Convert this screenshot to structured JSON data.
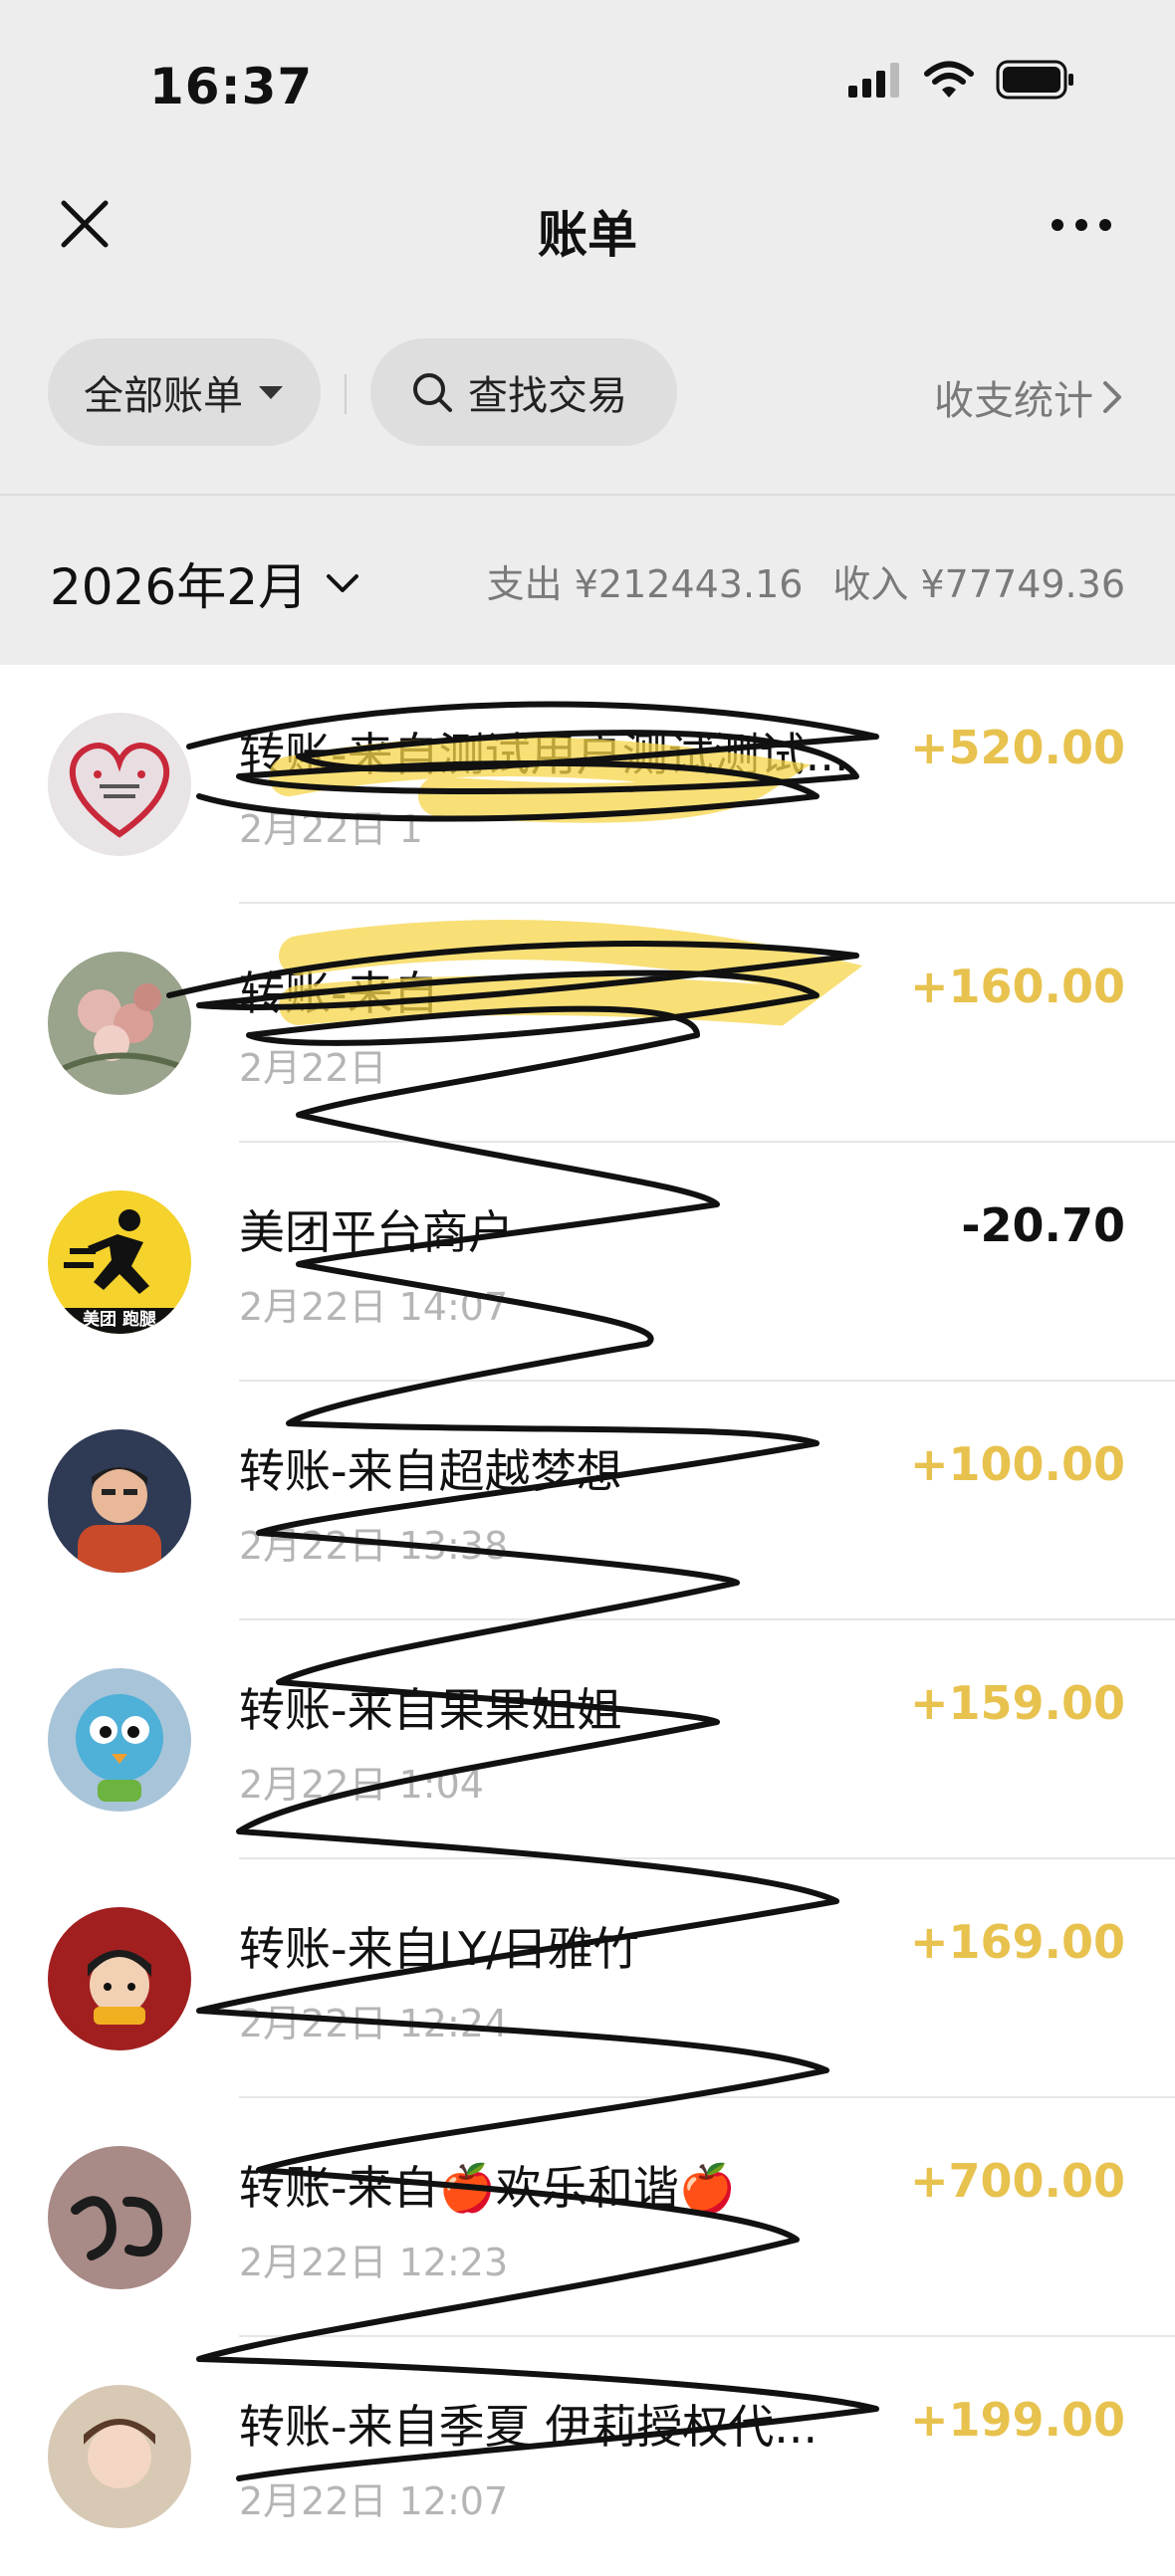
{
  "status_bar": {
    "time": "16:37"
  },
  "nav": {
    "title": "账单"
  },
  "filters": {
    "all_bills": "全部账单",
    "search": "查找交易",
    "stats": "收支统计"
  },
  "summary": {
    "month": "2026年2月",
    "expense": "支出 ¥212443.16",
    "income": "收入 ¥77749.36"
  },
  "transactions": [
    {
      "title": "转账-来自测试用户测试测试...",
      "time": "2月22日 1",
      "amount": "+520.00"
    },
    {
      "title": "转账-来自",
      "time": "2月22日",
      "amount": "+160.00"
    },
    {
      "title": "美团平台商户",
      "time": "2月22日 14:07",
      "amount": "-20.70"
    },
    {
      "title": "转账-来自超越梦想",
      "time": "2月22日 13:38",
      "amount": "+100.00"
    },
    {
      "title": "转账-来自果果姐姐",
      "time": "2月22日 1:04",
      "amount": "+159.00"
    },
    {
      "title": "转账-来自LY/日雅竹",
      "time": "2月22日 12:24",
      "amount": "+169.00"
    },
    {
      "title": "转账-来自🍎欢乐和谐🍎",
      "time": "2月22日 12:23",
      "amount": "+700.00"
    },
    {
      "title": "转账-来自季夏 伊莉授权代...",
      "time": "2月22日 12:07",
      "amount": "+199.00"
    }
  ],
  "avatars": {
    "meituan_label": "美团 跑腿"
  },
  "colors": {
    "income": "#e8c24e",
    "expense": "#111111",
    "header_bg": "#ededed"
  }
}
